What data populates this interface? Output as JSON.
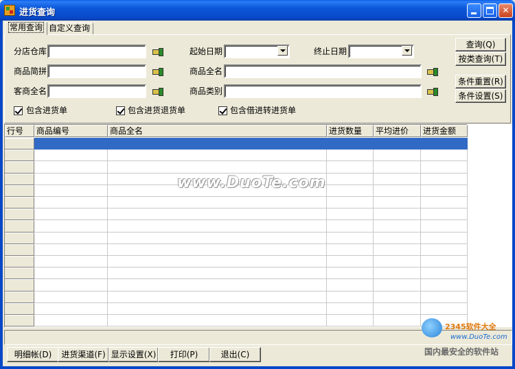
{
  "window": {
    "title": "进货查询",
    "controls": {
      "minimize": "",
      "maximize": "",
      "close": "✕"
    }
  },
  "tabs": [
    {
      "label": "常用查询",
      "active": true
    },
    {
      "label": "自定义查询",
      "active": false
    }
  ],
  "query": {
    "fields": {
      "branch_warehouse": {
        "label": "分店仓库",
        "value": ""
      },
      "product_short": {
        "label": "商品简拼",
        "value": ""
      },
      "supplier_full": {
        "label": "客商全名",
        "value": ""
      },
      "start_date": {
        "label": "起始日期",
        "value": ""
      },
      "product_full": {
        "label": "商品全名",
        "value": ""
      },
      "product_category": {
        "label": "商品类别",
        "value": ""
      },
      "end_date": {
        "label": "终止日期",
        "value": ""
      }
    },
    "checkboxes": [
      {
        "label": "包含进货单",
        "checked": true
      },
      {
        "label": "包含进货退货单",
        "checked": true
      },
      {
        "label": "包含借进转进货单",
        "checked": true
      }
    ],
    "buttons": {
      "query": "查询(Q)",
      "query_by_class": "按类查询(T)",
      "reset": "条件重置(R)",
      "settings": "条件设置(S)"
    }
  },
  "grid": {
    "columns": [
      "行号",
      "商品编号",
      "商品全名",
      "进货数量",
      "平均进价",
      "进货金额"
    ],
    "row_count": 16,
    "selected_row": 0
  },
  "watermark": "www.DuoTe.com",
  "footer_buttons": {
    "detail": "明细帐(D)",
    "channel": "进货渠道(F)",
    "display": "显示设置(X)",
    "print": "打印(P)",
    "exit": "退出(C)"
  },
  "logo": {
    "brand": "2345软件大全",
    "url": "www.DuoTe.com",
    "slogan": "国内最安全的软件站"
  }
}
